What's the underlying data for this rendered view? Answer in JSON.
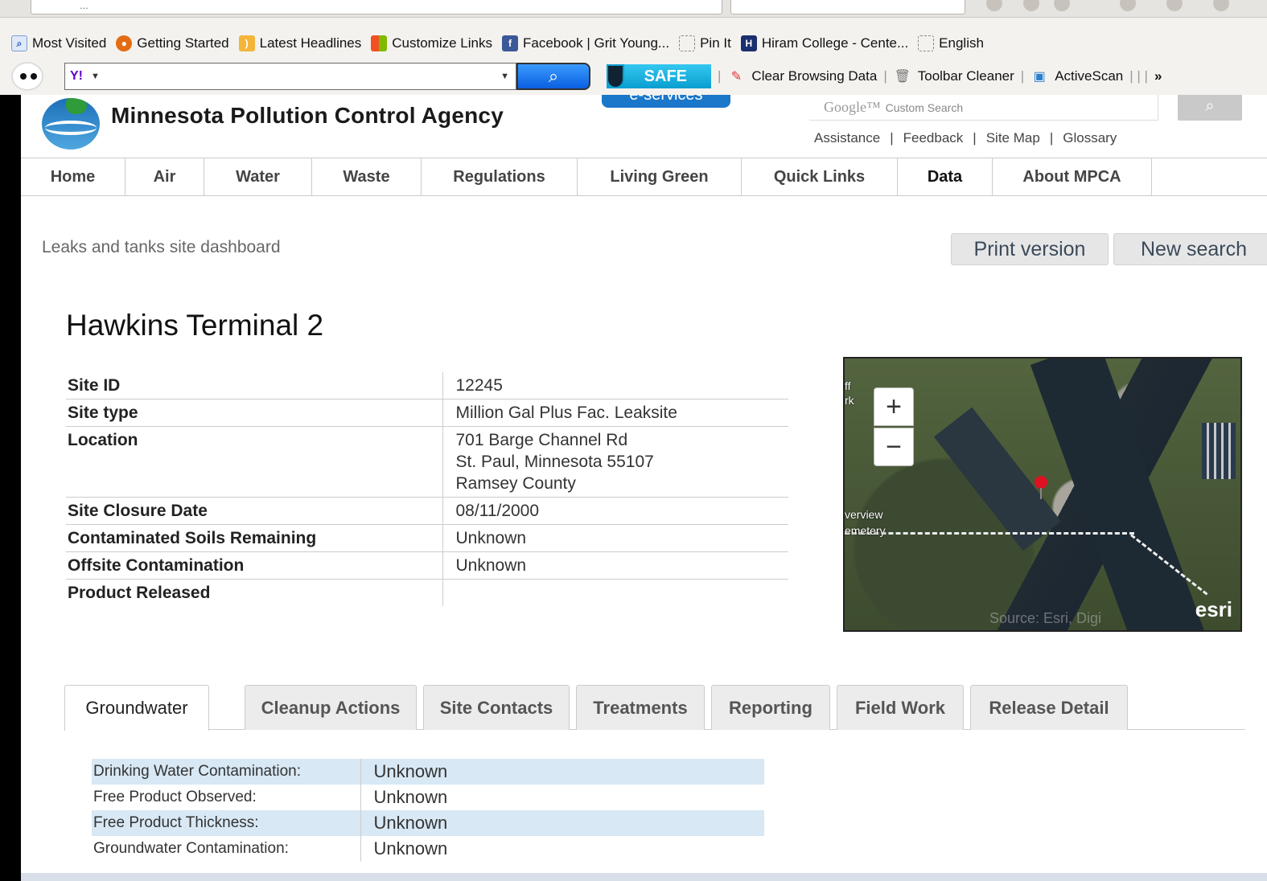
{
  "browser": {
    "url_text": "...",
    "bookmarks": [
      {
        "label": "Most Visited",
        "icon": "search-icon"
      },
      {
        "label": "Getting Started",
        "icon": "firefox-icon"
      },
      {
        "label": "Latest Headlines",
        "icon": "rss-icon"
      },
      {
        "label": "Customize Links",
        "icon": "windows-icon"
      },
      {
        "label": "Facebook | Grit Young...",
        "icon": "facebook-icon"
      },
      {
        "label": "Pin It",
        "icon": "page-icon"
      },
      {
        "label": "Hiram College - Cente...",
        "icon": "hiram-icon"
      },
      {
        "label": "English",
        "icon": "page-icon"
      }
    ],
    "toolbar": {
      "yahoo_logo": "Y!",
      "safe_label": "SAFE",
      "items": [
        "Clear Browsing Data",
        "Toolbar Cleaner",
        "ActiveScan"
      ],
      "overflow": "»"
    }
  },
  "site": {
    "agency_name": "Minnesota Pollution Control Agency",
    "eservices_label": "e-services",
    "search_logo": "Google™",
    "search_placeholder": "Custom Search",
    "top_links": [
      "Assistance",
      "Feedback",
      "Site Map",
      "Glossary"
    ],
    "nav": [
      {
        "label": "Home",
        "width": 130
      },
      {
        "label": "Air",
        "width": 98
      },
      {
        "label": "Water",
        "width": 134
      },
      {
        "label": "Waste",
        "width": 136
      },
      {
        "label": "Regulations",
        "width": 194
      },
      {
        "label": "Living Green",
        "width": 204
      },
      {
        "label": "Quick Links",
        "width": 194
      },
      {
        "label": "Data",
        "width": 118,
        "active": true
      },
      {
        "label": "About MPCA",
        "width": 198
      }
    ]
  },
  "dashboard": {
    "heading": "Leaks and tanks site dashboard",
    "print_label": "Print version",
    "new_search_label": "New search",
    "site_name": "Hawkins Terminal 2",
    "details": [
      {
        "key": "Site ID",
        "value": "12245"
      },
      {
        "key": "Site type",
        "value": "Million Gal Plus Fac. Leaksite"
      },
      {
        "key": "Location",
        "lines": [
          "701 Barge Channel Rd",
          "St. Paul, Minnesota 55107",
          "Ramsey County"
        ]
      },
      {
        "key": "Site Closure Date",
        "value": "08/11/2000"
      },
      {
        "key": "Contaminated Soils Remaining",
        "value": "Unknown"
      },
      {
        "key": "Offsite Contamination",
        "value": "Unknown"
      },
      {
        "key": "Product Released",
        "value": ""
      }
    ],
    "map": {
      "zoom_in": "+",
      "zoom_out": "−",
      "label_1": "ff",
      "label_2": "rk",
      "label_3": "verview",
      "label_4": "emetery",
      "source": "Source: Esri, Digi",
      "brand": "esri"
    },
    "tabs": [
      {
        "label": "Groundwater",
        "active": true
      },
      {
        "label": "Cleanup Actions"
      },
      {
        "label": "Site Contacts"
      },
      {
        "label": "Treatments"
      },
      {
        "label": "Reporting"
      },
      {
        "label": "Field Work"
      },
      {
        "label": "Release Detail"
      }
    ],
    "groundwater": [
      {
        "key": "Drinking Water Contamination:",
        "value": "Unknown"
      },
      {
        "key": "Free Product Observed:",
        "value": "Unknown"
      },
      {
        "key": "Free Product Thickness:",
        "value": "Unknown"
      },
      {
        "key": "Groundwater Contamination:",
        "value": "Unknown"
      }
    ]
  }
}
